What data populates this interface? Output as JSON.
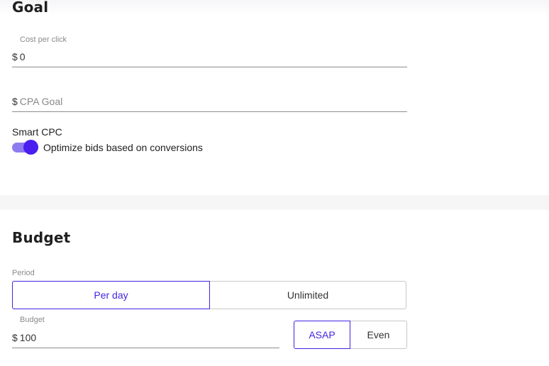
{
  "goal": {
    "title": "Goal",
    "cpc": {
      "label": "Cost per click",
      "prefix": "$",
      "value": "0"
    },
    "cpa": {
      "prefix": "$",
      "placeholder": "CPA Goal"
    },
    "smart_cpc": {
      "label": "Smart CPC",
      "toggle_on": true,
      "toggle_text": "Optimize bids based on conversions"
    }
  },
  "budget": {
    "title": "Budget",
    "period": {
      "label": "Period",
      "options": [
        "Per day",
        "Unlimited"
      ],
      "selected": "Per day"
    },
    "amount": {
      "label": "Budget",
      "prefix": "$",
      "value": "100"
    },
    "pacing": {
      "options": [
        "ASAP",
        "Even"
      ],
      "selected": "ASAP"
    }
  },
  "colors": {
    "accent": "#4424e0",
    "toggle_track": "#8f7bf0",
    "toggle_knob": "#4a1ff0"
  }
}
